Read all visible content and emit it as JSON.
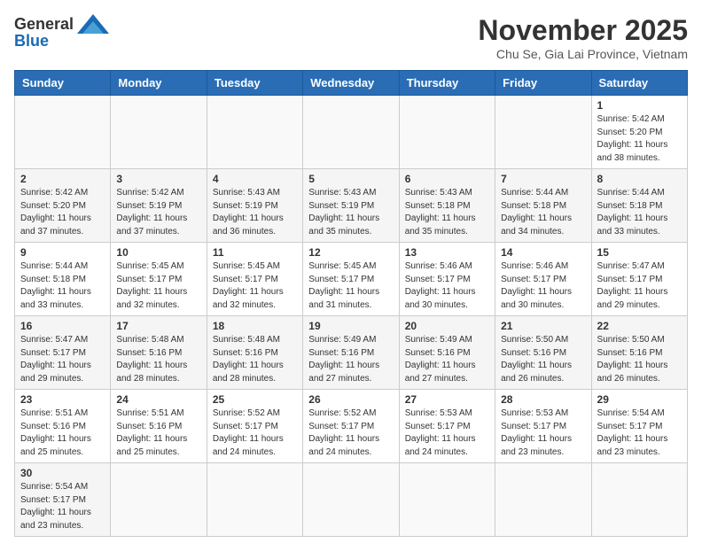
{
  "header": {
    "logo_general": "General",
    "logo_blue": "Blue",
    "month": "November 2025",
    "location": "Chu Se, Gia Lai Province, Vietnam"
  },
  "weekdays": [
    "Sunday",
    "Monday",
    "Tuesday",
    "Wednesday",
    "Thursday",
    "Friday",
    "Saturday"
  ],
  "weeks": [
    [
      {
        "day": "",
        "info": ""
      },
      {
        "day": "",
        "info": ""
      },
      {
        "day": "",
        "info": ""
      },
      {
        "day": "",
        "info": ""
      },
      {
        "day": "",
        "info": ""
      },
      {
        "day": "",
        "info": ""
      },
      {
        "day": "1",
        "info": "Sunrise: 5:42 AM\nSunset: 5:20 PM\nDaylight: 11 hours\nand 38 minutes."
      }
    ],
    [
      {
        "day": "2",
        "info": "Sunrise: 5:42 AM\nSunset: 5:20 PM\nDaylight: 11 hours\nand 37 minutes."
      },
      {
        "day": "3",
        "info": "Sunrise: 5:42 AM\nSunset: 5:19 PM\nDaylight: 11 hours\nand 37 minutes."
      },
      {
        "day": "4",
        "info": "Sunrise: 5:43 AM\nSunset: 5:19 PM\nDaylight: 11 hours\nand 36 minutes."
      },
      {
        "day": "5",
        "info": "Sunrise: 5:43 AM\nSunset: 5:19 PM\nDaylight: 11 hours\nand 35 minutes."
      },
      {
        "day": "6",
        "info": "Sunrise: 5:43 AM\nSunset: 5:18 PM\nDaylight: 11 hours\nand 35 minutes."
      },
      {
        "day": "7",
        "info": "Sunrise: 5:44 AM\nSunset: 5:18 PM\nDaylight: 11 hours\nand 34 minutes."
      },
      {
        "day": "8",
        "info": "Sunrise: 5:44 AM\nSunset: 5:18 PM\nDaylight: 11 hours\nand 33 minutes."
      }
    ],
    [
      {
        "day": "9",
        "info": "Sunrise: 5:44 AM\nSunset: 5:18 PM\nDaylight: 11 hours\nand 33 minutes."
      },
      {
        "day": "10",
        "info": "Sunrise: 5:45 AM\nSunset: 5:17 PM\nDaylight: 11 hours\nand 32 minutes."
      },
      {
        "day": "11",
        "info": "Sunrise: 5:45 AM\nSunset: 5:17 PM\nDaylight: 11 hours\nand 32 minutes."
      },
      {
        "day": "12",
        "info": "Sunrise: 5:45 AM\nSunset: 5:17 PM\nDaylight: 11 hours\nand 31 minutes."
      },
      {
        "day": "13",
        "info": "Sunrise: 5:46 AM\nSunset: 5:17 PM\nDaylight: 11 hours\nand 30 minutes."
      },
      {
        "day": "14",
        "info": "Sunrise: 5:46 AM\nSunset: 5:17 PM\nDaylight: 11 hours\nand 30 minutes."
      },
      {
        "day": "15",
        "info": "Sunrise: 5:47 AM\nSunset: 5:17 PM\nDaylight: 11 hours\nand 29 minutes."
      }
    ],
    [
      {
        "day": "16",
        "info": "Sunrise: 5:47 AM\nSunset: 5:17 PM\nDaylight: 11 hours\nand 29 minutes."
      },
      {
        "day": "17",
        "info": "Sunrise: 5:48 AM\nSunset: 5:16 PM\nDaylight: 11 hours\nand 28 minutes."
      },
      {
        "day": "18",
        "info": "Sunrise: 5:48 AM\nSunset: 5:16 PM\nDaylight: 11 hours\nand 28 minutes."
      },
      {
        "day": "19",
        "info": "Sunrise: 5:49 AM\nSunset: 5:16 PM\nDaylight: 11 hours\nand 27 minutes."
      },
      {
        "day": "20",
        "info": "Sunrise: 5:49 AM\nSunset: 5:16 PM\nDaylight: 11 hours\nand 27 minutes."
      },
      {
        "day": "21",
        "info": "Sunrise: 5:50 AM\nSunset: 5:16 PM\nDaylight: 11 hours\nand 26 minutes."
      },
      {
        "day": "22",
        "info": "Sunrise: 5:50 AM\nSunset: 5:16 PM\nDaylight: 11 hours\nand 26 minutes."
      }
    ],
    [
      {
        "day": "23",
        "info": "Sunrise: 5:51 AM\nSunset: 5:16 PM\nDaylight: 11 hours\nand 25 minutes."
      },
      {
        "day": "24",
        "info": "Sunrise: 5:51 AM\nSunset: 5:16 PM\nDaylight: 11 hours\nand 25 minutes."
      },
      {
        "day": "25",
        "info": "Sunrise: 5:52 AM\nSunset: 5:17 PM\nDaylight: 11 hours\nand 24 minutes."
      },
      {
        "day": "26",
        "info": "Sunrise: 5:52 AM\nSunset: 5:17 PM\nDaylight: 11 hours\nand 24 minutes."
      },
      {
        "day": "27",
        "info": "Sunrise: 5:53 AM\nSunset: 5:17 PM\nDaylight: 11 hours\nand 24 minutes."
      },
      {
        "day": "28",
        "info": "Sunrise: 5:53 AM\nSunset: 5:17 PM\nDaylight: 11 hours\nand 23 minutes."
      },
      {
        "day": "29",
        "info": "Sunrise: 5:54 AM\nSunset: 5:17 PM\nDaylight: 11 hours\nand 23 minutes."
      }
    ],
    [
      {
        "day": "30",
        "info": "Sunrise: 5:54 AM\nSunset: 5:17 PM\nDaylight: 11 hours\nand 23 minutes."
      },
      {
        "day": "",
        "info": ""
      },
      {
        "day": "",
        "info": ""
      },
      {
        "day": "",
        "info": ""
      },
      {
        "day": "",
        "info": ""
      },
      {
        "day": "",
        "info": ""
      },
      {
        "day": "",
        "info": ""
      }
    ]
  ]
}
